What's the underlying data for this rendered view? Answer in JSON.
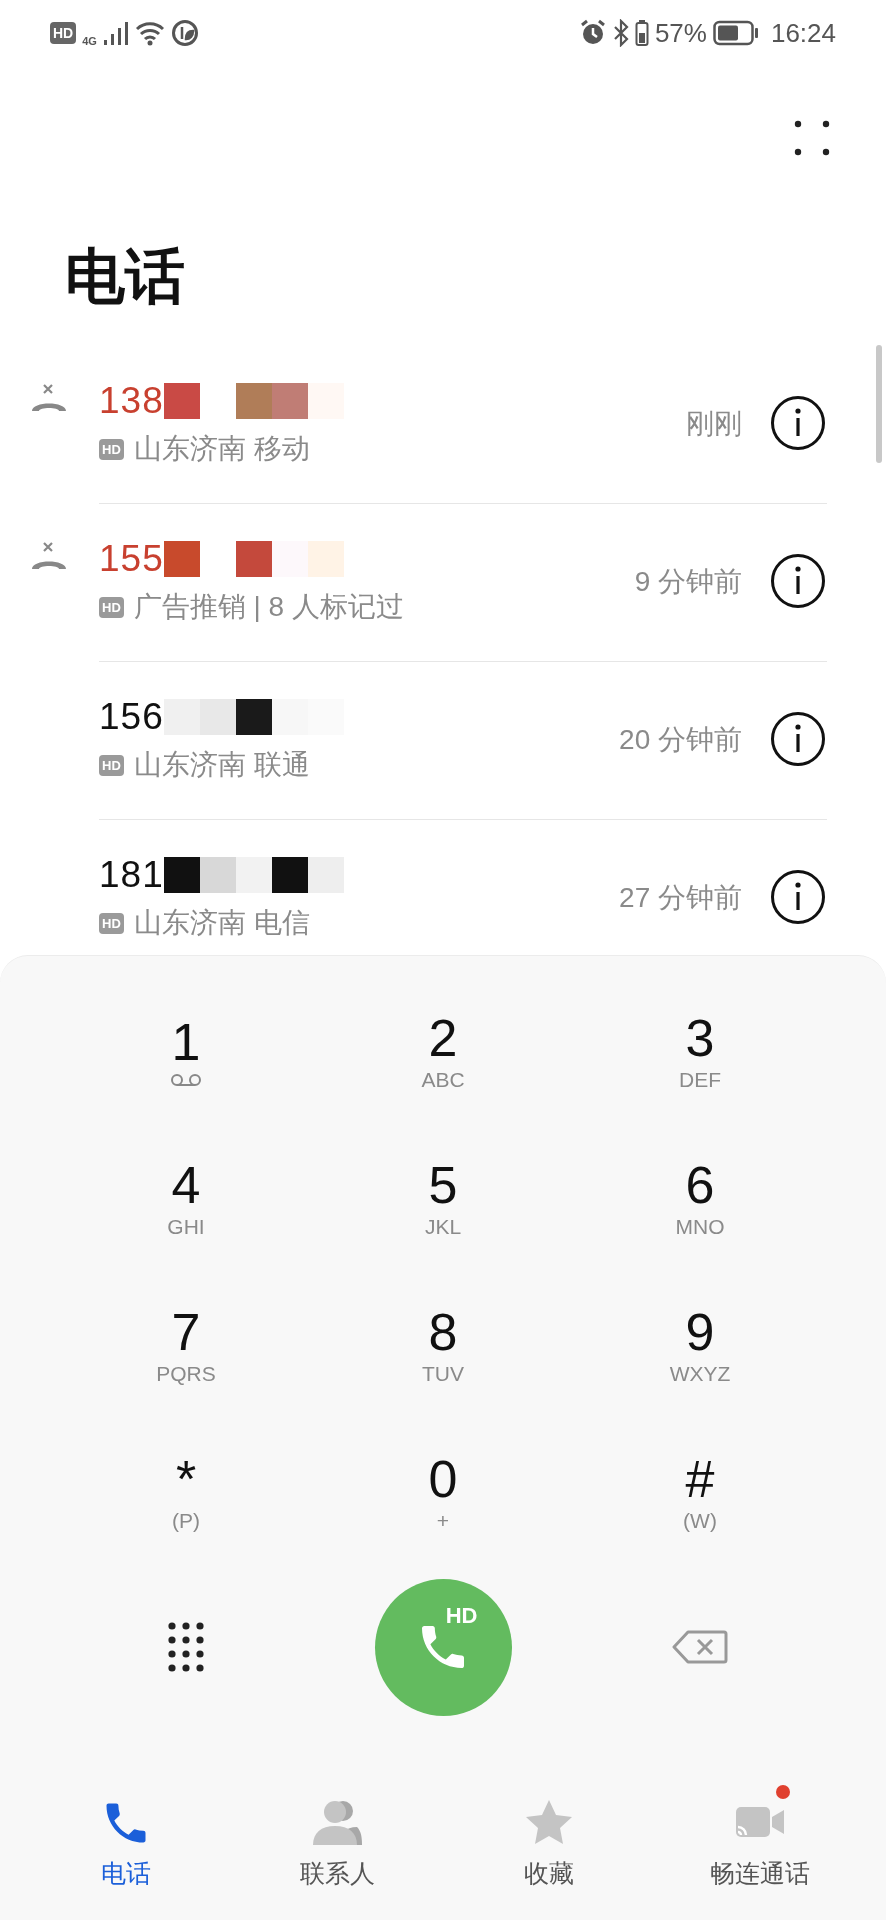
{
  "status_bar": {
    "hd_badge": "HD",
    "network": "4G",
    "battery_percent": "57%",
    "time": "16:24"
  },
  "title": "电话",
  "calls": [
    {
      "number": "138",
      "missed": true,
      "hd_label": "HD",
      "detail": "山东济南 移动",
      "time": "刚刚"
    },
    {
      "number": "155",
      "missed": true,
      "hd_label": "HD",
      "detail": "广告推销 | 8 人标记过",
      "time": "9 分钟前"
    },
    {
      "number": "156",
      "missed": false,
      "hd_label": "HD",
      "detail": "山东济南 联通",
      "time": "20 分钟前"
    },
    {
      "number": "181",
      "missed": false,
      "hd_label": "HD",
      "detail": "山东济南 电信",
      "time": "27 分钟前"
    }
  ],
  "dialpad": {
    "keys": [
      {
        "digit": "1",
        "kind": "voicemail"
      },
      {
        "digit": "2",
        "kind": "letters",
        "sub": "ABC"
      },
      {
        "digit": "3",
        "kind": "letters",
        "sub": "DEF"
      },
      {
        "digit": "4",
        "kind": "letters",
        "sub": "GHI"
      },
      {
        "digit": "5",
        "kind": "letters",
        "sub": "JKL"
      },
      {
        "digit": "6",
        "kind": "letters",
        "sub": "MNO"
      },
      {
        "digit": "7",
        "kind": "letters",
        "sub": "PQRS"
      },
      {
        "digit": "8",
        "kind": "letters",
        "sub": "TUV"
      },
      {
        "digit": "9",
        "kind": "letters",
        "sub": "WXYZ"
      },
      {
        "digit": "*",
        "kind": "letters",
        "sub": "(P)"
      },
      {
        "digit": "0",
        "kind": "letters",
        "sub": "+"
      },
      {
        "digit": "#",
        "kind": "letters",
        "sub": "(W)"
      }
    ],
    "call_label": "HD"
  },
  "nav": [
    {
      "label": "电话",
      "kind": "phone",
      "selected": true,
      "badge": false
    },
    {
      "label": "联系人",
      "kind": "contacts",
      "selected": false,
      "badge": false
    },
    {
      "label": "收藏",
      "kind": "star",
      "selected": false,
      "badge": false
    },
    {
      "label": "畅连通话",
      "kind": "video",
      "selected": false,
      "badge": true
    }
  ]
}
